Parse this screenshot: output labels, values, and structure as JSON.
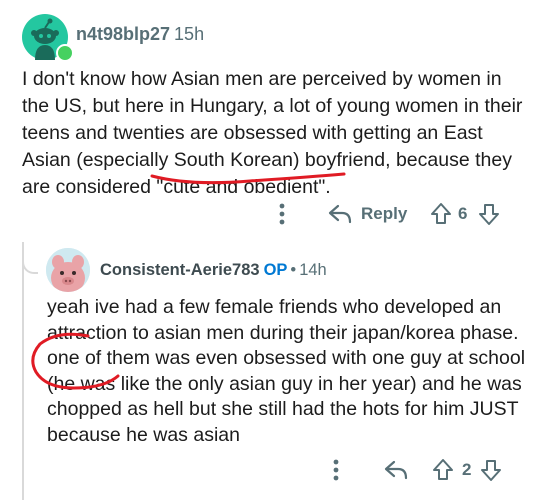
{
  "top_comment": {
    "username": "n4t98blp27",
    "time": "15h",
    "body": "I don't know how Asian men are perceived by women in the US, but here in Hungary, a lot of young women in their teens and twenties are obsessed with getting an East Asian (especially South Korean) boyfriend, because they are considered \"cute and obedient\".",
    "reply_label": "Reply",
    "vote_count": "6",
    "online": true,
    "icons": {
      "more": "more-vertical-icon",
      "reply": "reply-arrow-icon",
      "upvote": "upvote-arrow-icon",
      "downvote": "downvote-arrow-icon"
    }
  },
  "reply_comment": {
    "username": "Consistent-Aerie783",
    "op_badge": "OP",
    "separator": "•",
    "time": "14h",
    "body": "yeah ive had a few female friends who developed an attraction to asian men during their japan/korea phase. one of them was even obsessed with one guy at school (he was like the only asian guy in her year) and he was chopped as hell but she still had the hots for him JUST because he was asian",
    "vote_count": "2"
  },
  "colors": {
    "text": "#1c1c1c",
    "meta": "#576f76",
    "op_blue": "#0079d3",
    "annotation_red": "#e01b24",
    "online_green": "#46d160",
    "avatar_teal": "#24c7a0"
  }
}
